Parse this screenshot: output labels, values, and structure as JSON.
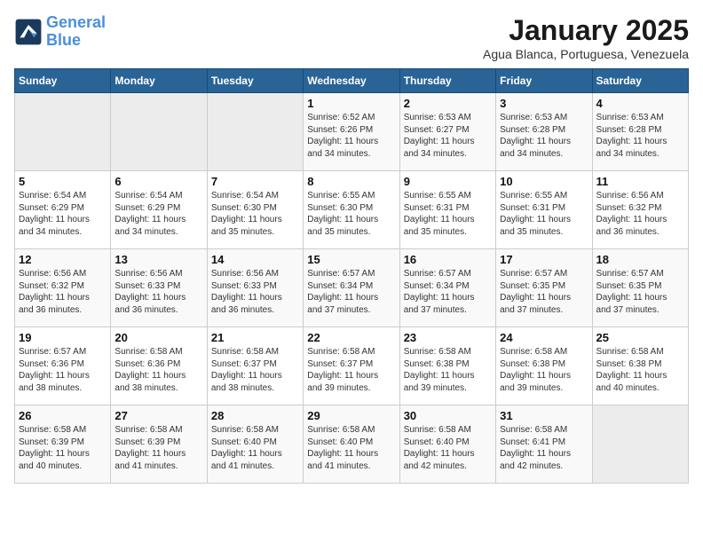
{
  "header": {
    "logo_line1": "General",
    "logo_line2": "Blue",
    "month": "January 2025",
    "location": "Agua Blanca, Portuguesa, Venezuela"
  },
  "weekdays": [
    "Sunday",
    "Monday",
    "Tuesday",
    "Wednesday",
    "Thursday",
    "Friday",
    "Saturday"
  ],
  "weeks": [
    [
      {
        "day": "",
        "info": ""
      },
      {
        "day": "",
        "info": ""
      },
      {
        "day": "",
        "info": ""
      },
      {
        "day": "1",
        "info": "Sunrise: 6:52 AM\nSunset: 6:26 PM\nDaylight: 11 hours\nand 34 minutes."
      },
      {
        "day": "2",
        "info": "Sunrise: 6:53 AM\nSunset: 6:27 PM\nDaylight: 11 hours\nand 34 minutes."
      },
      {
        "day": "3",
        "info": "Sunrise: 6:53 AM\nSunset: 6:28 PM\nDaylight: 11 hours\nand 34 minutes."
      },
      {
        "day": "4",
        "info": "Sunrise: 6:53 AM\nSunset: 6:28 PM\nDaylight: 11 hours\nand 34 minutes."
      }
    ],
    [
      {
        "day": "5",
        "info": "Sunrise: 6:54 AM\nSunset: 6:29 PM\nDaylight: 11 hours\nand 34 minutes."
      },
      {
        "day": "6",
        "info": "Sunrise: 6:54 AM\nSunset: 6:29 PM\nDaylight: 11 hours\nand 34 minutes."
      },
      {
        "day": "7",
        "info": "Sunrise: 6:54 AM\nSunset: 6:30 PM\nDaylight: 11 hours\nand 35 minutes."
      },
      {
        "day": "8",
        "info": "Sunrise: 6:55 AM\nSunset: 6:30 PM\nDaylight: 11 hours\nand 35 minutes."
      },
      {
        "day": "9",
        "info": "Sunrise: 6:55 AM\nSunset: 6:31 PM\nDaylight: 11 hours\nand 35 minutes."
      },
      {
        "day": "10",
        "info": "Sunrise: 6:55 AM\nSunset: 6:31 PM\nDaylight: 11 hours\nand 35 minutes."
      },
      {
        "day": "11",
        "info": "Sunrise: 6:56 AM\nSunset: 6:32 PM\nDaylight: 11 hours\nand 36 minutes."
      }
    ],
    [
      {
        "day": "12",
        "info": "Sunrise: 6:56 AM\nSunset: 6:32 PM\nDaylight: 11 hours\nand 36 minutes."
      },
      {
        "day": "13",
        "info": "Sunrise: 6:56 AM\nSunset: 6:33 PM\nDaylight: 11 hours\nand 36 minutes."
      },
      {
        "day": "14",
        "info": "Sunrise: 6:56 AM\nSunset: 6:33 PM\nDaylight: 11 hours\nand 36 minutes."
      },
      {
        "day": "15",
        "info": "Sunrise: 6:57 AM\nSunset: 6:34 PM\nDaylight: 11 hours\nand 37 minutes."
      },
      {
        "day": "16",
        "info": "Sunrise: 6:57 AM\nSunset: 6:34 PM\nDaylight: 11 hours\nand 37 minutes."
      },
      {
        "day": "17",
        "info": "Sunrise: 6:57 AM\nSunset: 6:35 PM\nDaylight: 11 hours\nand 37 minutes."
      },
      {
        "day": "18",
        "info": "Sunrise: 6:57 AM\nSunset: 6:35 PM\nDaylight: 11 hours\nand 37 minutes."
      }
    ],
    [
      {
        "day": "19",
        "info": "Sunrise: 6:57 AM\nSunset: 6:36 PM\nDaylight: 11 hours\nand 38 minutes."
      },
      {
        "day": "20",
        "info": "Sunrise: 6:58 AM\nSunset: 6:36 PM\nDaylight: 11 hours\nand 38 minutes."
      },
      {
        "day": "21",
        "info": "Sunrise: 6:58 AM\nSunset: 6:37 PM\nDaylight: 11 hours\nand 38 minutes."
      },
      {
        "day": "22",
        "info": "Sunrise: 6:58 AM\nSunset: 6:37 PM\nDaylight: 11 hours\nand 39 minutes."
      },
      {
        "day": "23",
        "info": "Sunrise: 6:58 AM\nSunset: 6:38 PM\nDaylight: 11 hours\nand 39 minutes."
      },
      {
        "day": "24",
        "info": "Sunrise: 6:58 AM\nSunset: 6:38 PM\nDaylight: 11 hours\nand 39 minutes."
      },
      {
        "day": "25",
        "info": "Sunrise: 6:58 AM\nSunset: 6:38 PM\nDaylight: 11 hours\nand 40 minutes."
      }
    ],
    [
      {
        "day": "26",
        "info": "Sunrise: 6:58 AM\nSunset: 6:39 PM\nDaylight: 11 hours\nand 40 minutes."
      },
      {
        "day": "27",
        "info": "Sunrise: 6:58 AM\nSunset: 6:39 PM\nDaylight: 11 hours\nand 41 minutes."
      },
      {
        "day": "28",
        "info": "Sunrise: 6:58 AM\nSunset: 6:40 PM\nDaylight: 11 hours\nand 41 minutes."
      },
      {
        "day": "29",
        "info": "Sunrise: 6:58 AM\nSunset: 6:40 PM\nDaylight: 11 hours\nand 41 minutes."
      },
      {
        "day": "30",
        "info": "Sunrise: 6:58 AM\nSunset: 6:40 PM\nDaylight: 11 hours\nand 42 minutes."
      },
      {
        "day": "31",
        "info": "Sunrise: 6:58 AM\nSunset: 6:41 PM\nDaylight: 11 hours\nand 42 minutes."
      },
      {
        "day": "",
        "info": ""
      }
    ]
  ]
}
